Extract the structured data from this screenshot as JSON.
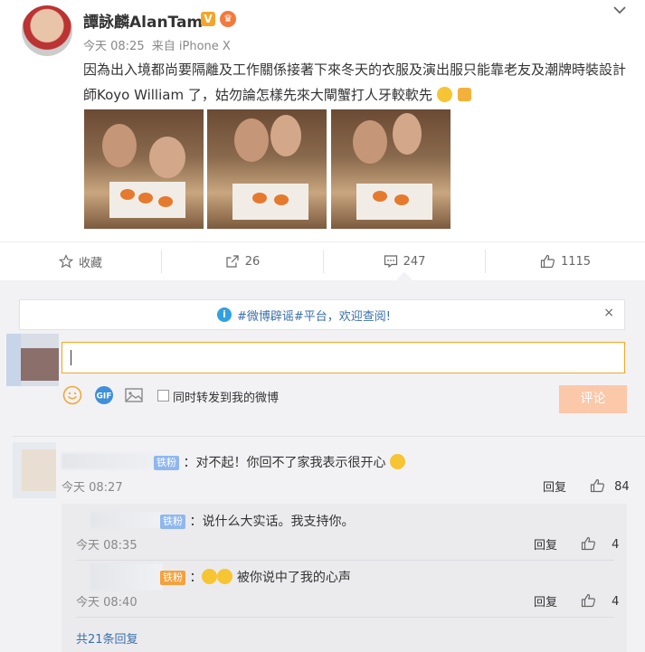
{
  "post": {
    "author": "譚詠麟AlanTam",
    "verified_badge": "V",
    "time": "今天 08:25",
    "source": "来自 iPhone X",
    "text": "因為出入境都尚要隔離及工作關係接著下來冬天的衣服及演出服只能靠老友及潮牌時裝設計師Koyo William 了，姑勿論怎樣先來大閘蟹打人牙較軟先",
    "photos": [
      "photo-1",
      "photo-2",
      "photo-3"
    ]
  },
  "actions": {
    "favorite": "收藏",
    "repost_count": "26",
    "comment_count": "247",
    "like_count": "1115"
  },
  "notice": {
    "text": "#微博辟谣#平台，欢迎查阅!",
    "close": "×"
  },
  "composer": {
    "forward_label": "同时转发到我的微博",
    "send_label": "评论",
    "icons": [
      "smile-icon",
      "gif-icon",
      "image-icon"
    ]
  },
  "comments": [
    {
      "badge": "铁粉",
      "text": "对不起！你回不了家我表示很开心",
      "time": "今天 08:27",
      "reply_label": "回复",
      "likes": "84",
      "replies": [
        {
          "badge": "铁粉",
          "text": "说什么大实话。我支持你。",
          "time": "今天 08:35",
          "reply_label": "回复",
          "likes": "4"
        },
        {
          "badge": "铁粉",
          "text": "被你说中了我的心声",
          "time": "今天 08:40",
          "reply_label": "回复",
          "likes": "4"
        }
      ],
      "more_replies": "共21条回复"
    }
  ],
  "colors": {
    "accent_link": "#3b6fab",
    "send_button": "#fbc8a9",
    "input_border": "#f5a623",
    "fan_badge": "#8fb7ee"
  }
}
